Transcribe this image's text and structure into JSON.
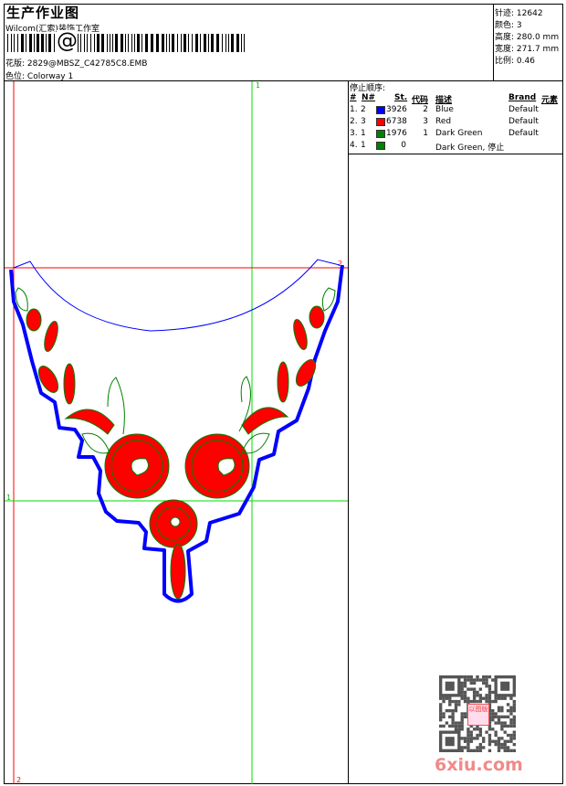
{
  "header": {
    "title": "生产作业图",
    "company": "Wilcom(汇索)装饰工作室",
    "barcode_symbol": "@",
    "design_label": "花版:",
    "design_value": "2829@MBSZ_C42785C8.EMB",
    "colorway_label": "色位:",
    "colorway_value": "Colorway 1"
  },
  "info": {
    "stitches_label": "针迹:",
    "stitches": "12642",
    "colors_label": "颜色:",
    "colors": "3",
    "height_label": "高度:",
    "height": "280.0 mm",
    "width_label": "宽度:",
    "width": "271.7 mm",
    "scale_label": "比例:",
    "scale": "0.46"
  },
  "stop_sequence": {
    "title": "停止顺序:",
    "headers": [
      "#",
      "N#",
      "St.",
      "代码",
      "描述",
      "Brand",
      "元素"
    ],
    "rows": [
      {
        "idx": "1.",
        "n": "2",
        "color": "#0000ff",
        "st": "3926",
        "code": "2",
        "desc": "Blue",
        "brand": "Default"
      },
      {
        "idx": "2.",
        "n": "3",
        "color": "#ff0000",
        "st": "6738",
        "code": "3",
        "desc": "Red",
        "brand": "Default"
      },
      {
        "idx": "3.",
        "n": "1",
        "color": "#008000",
        "st": "1976",
        "code": "1",
        "desc": "Dark Green",
        "brand": "Default"
      },
      {
        "idx": "4.",
        "n": "1",
        "color": "#008000",
        "st": "0",
        "code": "",
        "desc": "Dark Green, 停止",
        "brand": ""
      }
    ]
  },
  "guides": {
    "top_label": "1",
    "left_label": "1",
    "right_label": "2",
    "bottom_label": "2"
  },
  "colors": {
    "blue": "#0000ff",
    "red": "#ff0000",
    "green": "#008000",
    "guide_green": "#00dd00",
    "guide_red": "#ff0000"
  },
  "watermark": "6xiu.com",
  "stamp_text": "以图版"
}
